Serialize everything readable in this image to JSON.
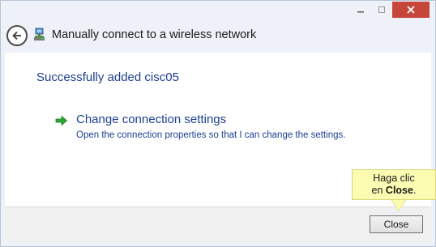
{
  "window": {
    "title": "Manually connect to a wireless network",
    "caption_buttons": [
      "minimize-icon",
      "maximize-icon",
      "close-icon"
    ],
    "accent_close_color": "#c7463b"
  },
  "header": {
    "back_icon": "back-arrow-icon",
    "network_icon": "wireless-network-icon"
  },
  "content": {
    "success_message": "Successfully added cisc05",
    "link": {
      "icon": "green-arrow-icon",
      "title": "Change connection settings",
      "description": "Open the connection properties so that I can change the settings."
    }
  },
  "footer": {
    "close_label": "Close"
  },
  "callout": {
    "line1": "Haga clic",
    "line2_prefix": "en ",
    "line2_bold": "Close",
    "line2_suffix": "."
  },
  "colors": {
    "link_blue": "#1d3f8f",
    "callout_yellow": "#fbfbb2",
    "chrome_bg": "#eef2f8"
  }
}
